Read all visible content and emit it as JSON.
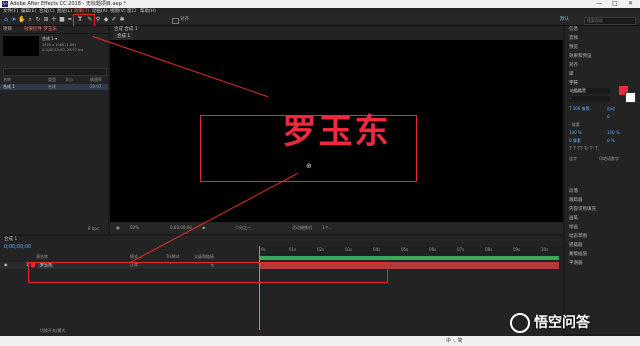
{
  "window": {
    "title": "Adobe After Effects CC 2018 - 无标题项目.aep *",
    "min": "—",
    "max": "□",
    "close": "✕"
  },
  "menu": [
    "文件(F)",
    "编辑(E)",
    "合成(C)",
    "图层(L)",
    "效果(T)",
    "动画(A)",
    "视图(V)",
    "窗口",
    "帮助(H)"
  ],
  "toolbar": {
    "align_label": "对齐",
    "workspace": "默认",
    "search_placeholder": "搜索帮助"
  },
  "project": {
    "tab": "项目",
    "effects_tab": "效果控件 罗玉东",
    "comp_name": "合成 1 ▾",
    "comp_info1": "1920 x 1080 (1.00)",
    "comp_info2": "Δ 0;00;10;00, 29.97 fps",
    "cols": {
      "name": "名称",
      "type": "类型",
      "size": "大小",
      "fps": "帧速率"
    },
    "item": {
      "name": "合成 1",
      "type": "合成",
      "fps": "29.97"
    },
    "bpc": "8 bpc"
  },
  "comp": {
    "tab": "合成 合成 1",
    "breadcrumb": "合成 1",
    "layer_text": "罗玉东",
    "zoom": "50%",
    "timecode": "0;00;00;00",
    "quality": "二分之一",
    "camera": "活动摄像机",
    "views": "1个..."
  },
  "timeline": {
    "tab": "合成 1",
    "timecode": "0;00;00;00",
    "cols": {
      "source": "源名称",
      "mode": "模式",
      "trkmat": "TrkMat",
      "parent": "父级和链接"
    },
    "layer": {
      "num": "1",
      "name": "罗玉东",
      "mode": "正常",
      "parent": "无"
    },
    "ruler": [
      "0s",
      "01s",
      "02s",
      "03s",
      "04s",
      "05s",
      "06s",
      "07s",
      "08s",
      "09s",
      "10s"
    ],
    "footer": "切换开关/模式"
  },
  "right": {
    "items_top": [
      "信息",
      "音频",
      "预览",
      "效果和预设",
      "对齐",
      "库"
    ],
    "char_tab": "字符",
    "font": "站酷酷黑",
    "font_style": "-",
    "size": "T 166 像素",
    "leading": "自动",
    "tracking": "0",
    "stroke": "- 像素",
    "scale_v": "100 %",
    "scale_h": "100 %",
    "baseline": "0 像素",
    "tsume": "0 %",
    "style_row": "T T TT Tr T' T,",
    "ligatures": "连字",
    "hindi": "印地语数字",
    "items_bottom": [
      "段落",
      "跟踪器",
      "内容识别填充",
      "画笔",
      "绘画",
      "动态草图",
      "摇摆器",
      "蒙版插值",
      "平滑器"
    ]
  },
  "watermark": "悟空问答",
  "status": {
    "ime": "中 ·, 简"
  },
  "colors": {
    "accent_red": "#e52b2b",
    "text_red": "#f0293d",
    "timeline_green": "#3aa85a"
  }
}
